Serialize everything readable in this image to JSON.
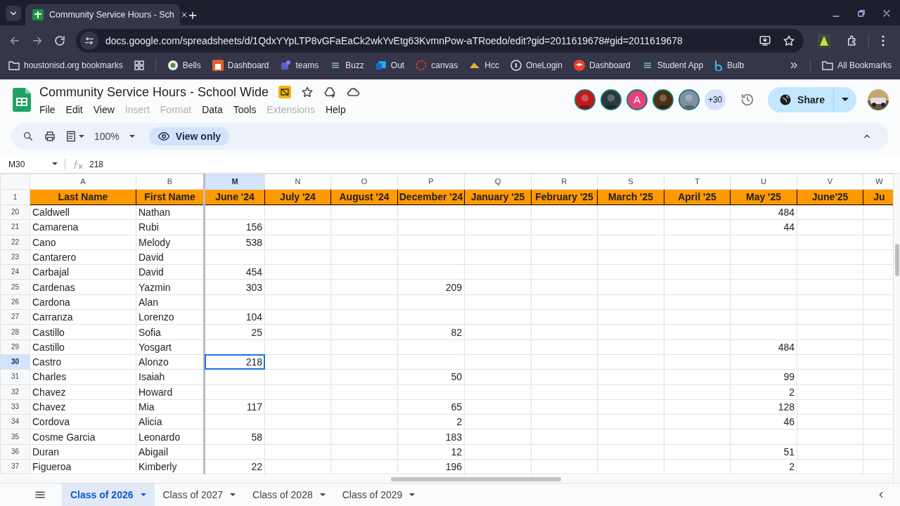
{
  "browser": {
    "tab_title": "Community Service Hours - Sch",
    "url": "docs.google.com/spreadsheets/d/1QdxYYpLTP8vGFaEaCk2wkYvEtg63KvmnPow-aTRoedo/edit?gid=2011619678#gid=2011619678",
    "bookmarks": [
      "houstonisd.org bookmarks",
      "Bells",
      "Dashboard",
      "teams",
      "Buzz",
      "Out",
      "canvas",
      "Hcc",
      "OneLogin",
      "Dashboard",
      "Student App",
      "Bulb"
    ],
    "all_bookmarks": "All Bookmarks"
  },
  "doc": {
    "title": "Community Service Hours - School Wide",
    "menu": [
      {
        "label": "File",
        "disabled": false
      },
      {
        "label": "Edit",
        "disabled": false
      },
      {
        "label": "View",
        "disabled": false
      },
      {
        "label": "Insert",
        "disabled": true
      },
      {
        "label": "Format",
        "disabled": true
      },
      {
        "label": "Data",
        "disabled": false
      },
      {
        "label": "Tools",
        "disabled": false
      },
      {
        "label": "Extensions",
        "disabled": true
      },
      {
        "label": "Help",
        "disabled": false
      }
    ],
    "collaborators": [
      {
        "kind": "picture",
        "color": "#c01818"
      },
      {
        "kind": "picture",
        "color": "#2a3a3a"
      },
      {
        "kind": "letter",
        "letter": "A",
        "color": "#e8407a"
      },
      {
        "kind": "picture",
        "color": "#4a3010"
      },
      {
        "kind": "picture",
        "color": "#8090a0"
      }
    ],
    "more_collaborators": "+30",
    "share": "Share"
  },
  "toolbar": {
    "zoom": "100%",
    "mode": "View only"
  },
  "formula_bar": {
    "cell": "M30",
    "value": "218"
  },
  "columns": [
    {
      "letter": "A",
      "header": "Last Name",
      "selected": false
    },
    {
      "letter": "B",
      "header": "First Name",
      "selected": false
    },
    {
      "letter": "M",
      "header": "June '24",
      "selected": true
    },
    {
      "letter": "N",
      "header": "July '24",
      "selected": false
    },
    {
      "letter": "O",
      "header": "August '24",
      "selected": false
    },
    {
      "letter": "P",
      "header": "December '24",
      "selected": false
    },
    {
      "letter": "Q",
      "header": "January '25",
      "selected": false
    },
    {
      "letter": "R",
      "header": "February '25",
      "selected": false
    },
    {
      "letter": "S",
      "header": "March '25",
      "selected": false
    },
    {
      "letter": "T",
      "header": "April '25",
      "selected": false
    },
    {
      "letter": "U",
      "header": "May '25",
      "selected": false
    },
    {
      "letter": "V",
      "header": "June'25",
      "selected": false
    },
    {
      "letter": "W",
      "header": "Ju",
      "selected": false
    }
  ],
  "header_row_number": "1",
  "rows": [
    {
      "number": "20",
      "selected": false,
      "cells": {
        "A": "Caldwell",
        "B": "Nathan",
        "U": "484"
      }
    },
    {
      "number": "21",
      "selected": false,
      "cells": {
        "A": "Camarena",
        "B": "Rubi",
        "M": "156",
        "U": "44"
      }
    },
    {
      "number": "22",
      "selected": false,
      "cells": {
        "A": "Cano",
        "B": "Melody",
        "M": "538"
      }
    },
    {
      "number": "23",
      "selected": false,
      "cells": {
        "A": "Cantarero",
        "B": "David"
      }
    },
    {
      "number": "24",
      "selected": false,
      "cells": {
        "A": "Carbajal",
        "B": "David",
        "M": "454"
      }
    },
    {
      "number": "25",
      "selected": false,
      "cells": {
        "A": "Cardenas",
        "B": "Yazmin",
        "M": "303",
        "P": "209"
      }
    },
    {
      "number": "26",
      "selected": false,
      "cells": {
        "A": "Cardona",
        "B": "Alan"
      }
    },
    {
      "number": "27",
      "selected": false,
      "cells": {
        "A": "Carranza",
        "B": "Lorenzo",
        "M": "104"
      }
    },
    {
      "number": "28",
      "selected": false,
      "cells": {
        "A": "Castillo",
        "B": "Sofia",
        "M": "25",
        "P": "82"
      }
    },
    {
      "number": "29",
      "selected": false,
      "cells": {
        "A": "Castillo",
        "B": "Yosgart",
        "U": "484"
      }
    },
    {
      "number": "30",
      "selected": true,
      "cells": {
        "A": "Castro",
        "B": "Alonzo",
        "M": "218"
      }
    },
    {
      "number": "31",
      "selected": false,
      "cells": {
        "A": "Charles",
        "B": "Isaiah",
        "P": "50",
        "U": "99"
      }
    },
    {
      "number": "32",
      "selected": false,
      "cells": {
        "A": "Chavez",
        "B": "Howard",
        "U": "2"
      }
    },
    {
      "number": "33",
      "selected": false,
      "cells": {
        "A": "Chavez",
        "B": "Mia",
        "M": "117",
        "P": "65",
        "U": "128"
      }
    },
    {
      "number": "34",
      "selected": false,
      "cells": {
        "A": "Cordova",
        "B": "Alicia",
        "P": "2",
        "U": "46"
      }
    },
    {
      "number": "35",
      "selected": false,
      "cells": {
        "A": "Cosme Garcia",
        "B": "Leonardo",
        "M": "58",
        "P": "183"
      }
    },
    {
      "number": "36",
      "selected": false,
      "cells": {
        "A": "Duran",
        "B": "Abigail",
        "P": "12",
        "U": "51"
      }
    },
    {
      "number": "37",
      "selected": false,
      "cells": {
        "A": "Figueroa",
        "B": "Kimberly",
        "M": "22",
        "P": "196",
        "U": "2"
      }
    }
  ],
  "sheet_tabs": [
    {
      "label": "Class of 2026",
      "selected": true
    },
    {
      "label": "Class of 2027",
      "selected": false
    },
    {
      "label": "Class of 2028",
      "selected": false
    },
    {
      "label": "Class of 2029",
      "selected": false
    }
  ]
}
